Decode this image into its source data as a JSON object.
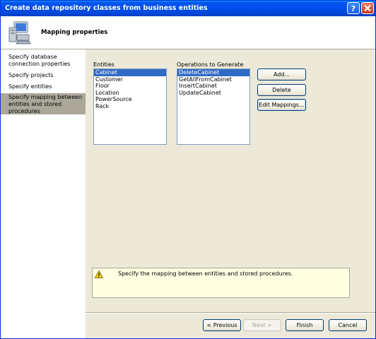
{
  "window": {
    "title": "Create data repository classes from business entities"
  },
  "header": {
    "title": "Mapping properties",
    "icon": "computer-icon"
  },
  "nav": {
    "items": [
      {
        "label": "Specify database connection properties",
        "lines": [
          "Specify database",
          "connection properties"
        ]
      },
      {
        "label": "Specify projects"
      },
      {
        "label": "Specify entities"
      },
      {
        "label": "Specify mapping between entities and stored procedures",
        "lines": [
          "Specify mapping between",
          "entities and stored",
          "procedures"
        ],
        "active": true
      }
    ]
  },
  "entities": {
    "label": "Entities",
    "items": [
      "Cabinet",
      "Customer",
      "Floor",
      "Location",
      "PowerSource",
      "Rack"
    ],
    "selected": "Cabinet"
  },
  "operations": {
    "label": "Operations to Generate",
    "items": [
      "DeleteCabinet",
      "GetAllFromCabinet",
      "InsertCabinet",
      "UpdateCabinet"
    ],
    "selected": "DeleteCabinet"
  },
  "buttons": {
    "add": "Add...",
    "delete": "Delete",
    "edit_mappings": "Edit Mappings..."
  },
  "info": {
    "text": "Specify the mapping between entities and stored procedures.",
    "icon": "warning-icon"
  },
  "footer": {
    "previous": "< Previous",
    "next": "Next >",
    "finish": "Finish",
    "cancel": "Cancel"
  },
  "colors": {
    "titlebar": "#0054e3",
    "selection": "#316ac5",
    "active_nav": "#aca899",
    "info_bg": "#ffffe1"
  }
}
